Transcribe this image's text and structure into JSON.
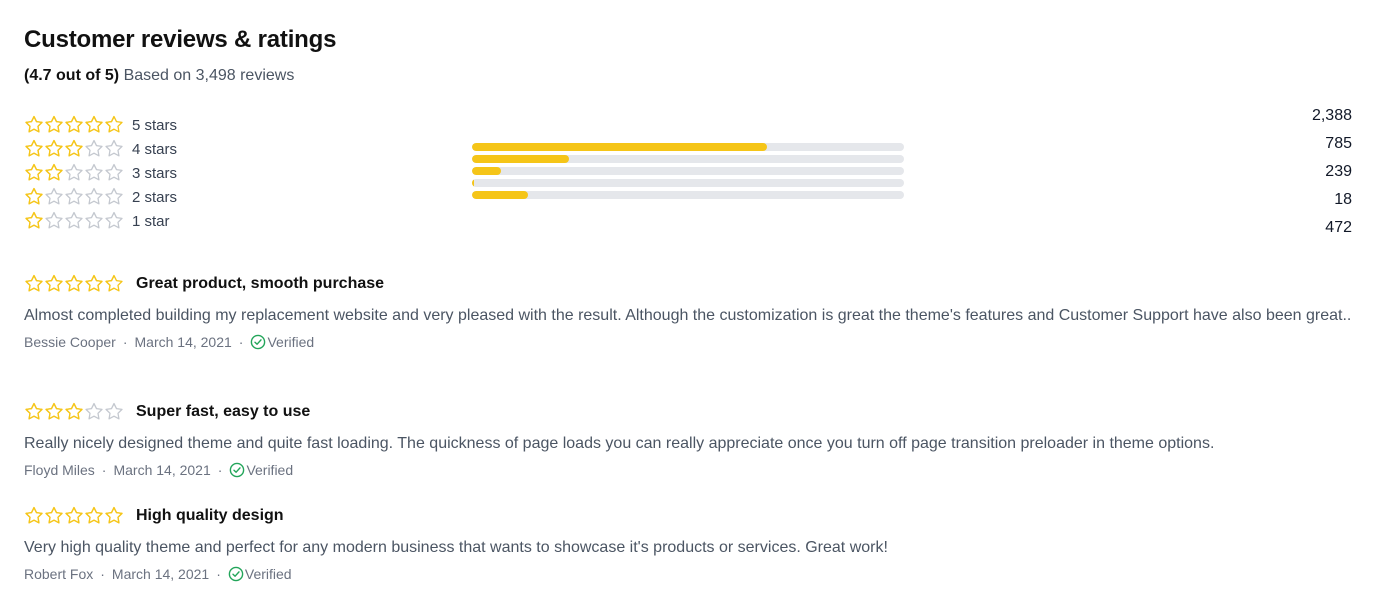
{
  "title": "Customer reviews & ratings",
  "summary": {
    "average": "(4.7 out of 5)",
    "based_on": "Based on 3,498 reviews"
  },
  "colors": {
    "star": "#f5c518",
    "star_empty": "#c4c8cf",
    "bar_track": "#e5e7eb",
    "bar_fill": "#f5c518",
    "verified": "#22a55a"
  },
  "breakdown": [
    {
      "label": "5 stars",
      "stars": 4.5,
      "count": "2,388",
      "fill": 0.682
    },
    {
      "label": "4 stars",
      "stars": 3,
      "count": "785",
      "fill": 0.224
    },
    {
      "label": "3 stars",
      "stars": 2,
      "count": "239",
      "fill": 0.068
    },
    {
      "label": "2 stars",
      "stars": 1,
      "count": "18",
      "fill": 0.005
    },
    {
      "label": "1 star",
      "stars": 1,
      "count": "472",
      "fill": 0.13
    }
  ],
  "reviews": [
    {
      "stars": 4.5,
      "title": "Great product, smooth purchase",
      "body": "Almost completed building my replacement website and very pleased with the result. Although the customization is great the theme's features and Customer Support have also been great..",
      "author": "Bessie Cooper",
      "date": "March 14, 2021",
      "verified": "Verified"
    },
    {
      "stars": 3,
      "title": "Super fast, easy to use",
      "body": "Really nicely designed theme and quite fast loading. The quickness of page loads you can really appreciate once you turn off page transition preloader in theme options.",
      "author": "Floyd Miles",
      "date": "March 14, 2021",
      "verified": "Verified"
    },
    {
      "stars": 5,
      "title": "High quality design",
      "body": "Very high quality theme and perfect for any modern business that wants to showcase it's products or services. Great work!",
      "author": "Robert Fox",
      "date": "March 14, 2021",
      "verified": "Verified"
    }
  ]
}
